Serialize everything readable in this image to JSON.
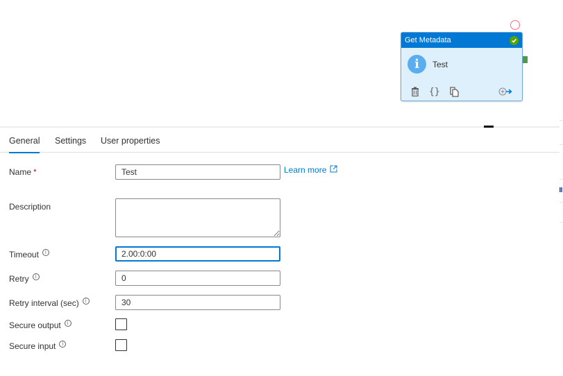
{
  "canvas": {
    "activity": {
      "type_label": "Get Metadata",
      "name": "Test",
      "status": "succeeded",
      "icon": "info-icon",
      "actions": [
        {
          "name": "delete",
          "icon": "trash-icon"
        },
        {
          "name": "view-code",
          "icon": "braces-icon"
        },
        {
          "name": "clone",
          "icon": "copy-icon"
        },
        {
          "name": "add-output",
          "icon": "add-output-arrow-icon"
        }
      ]
    },
    "colors": {
      "header": "#0078d4",
      "body": "#def0fc",
      "success": "#57a300",
      "failure_handle": "#f1707b",
      "success_handle": "#4a9a4a"
    }
  },
  "tabs": [
    {
      "label": "General",
      "active": true
    },
    {
      "label": "Settings",
      "active": false
    },
    {
      "label": "User properties",
      "active": false
    }
  ],
  "form": {
    "name": {
      "label": "Name",
      "required_marker": "*",
      "value": "Test"
    },
    "learn_more": {
      "label": "Learn more"
    },
    "description": {
      "label": "Description",
      "value": ""
    },
    "timeout": {
      "label": "Timeout",
      "value": "2.00:0:00"
    },
    "retry": {
      "label": "Retry",
      "value": "0"
    },
    "retry_interval": {
      "label": "Retry interval (sec)",
      "value": "30"
    },
    "secure_output": {
      "label": "Secure output",
      "checked": false
    },
    "secure_input": {
      "label": "Secure input",
      "checked": false
    }
  },
  "accent_color": "#0078d4"
}
